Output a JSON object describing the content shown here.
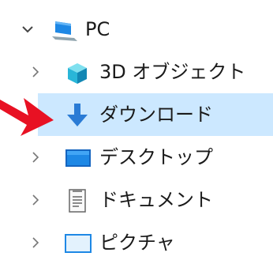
{
  "tree": {
    "items": [
      {
        "label": "PC",
        "icon": "pc-monitor-icon",
        "expanded": true
      },
      {
        "label": "3D オブジェクト",
        "icon": "3d-objects-icon",
        "expanded": false
      },
      {
        "label": "ダウンロード",
        "icon": "download-arrow-icon",
        "expanded": false,
        "selected": true
      },
      {
        "label": "デスクトップ",
        "icon": "desktop-icon",
        "expanded": false
      },
      {
        "label": "ドキュメント",
        "icon": "document-icon",
        "expanded": false
      },
      {
        "label": "ピクチャ",
        "icon": "pictures-icon",
        "expanded": false
      }
    ]
  },
  "colors": {
    "selection": "#cce8ff",
    "arrow_red": "#e81123",
    "folder_blue": "#2a7bd5"
  }
}
